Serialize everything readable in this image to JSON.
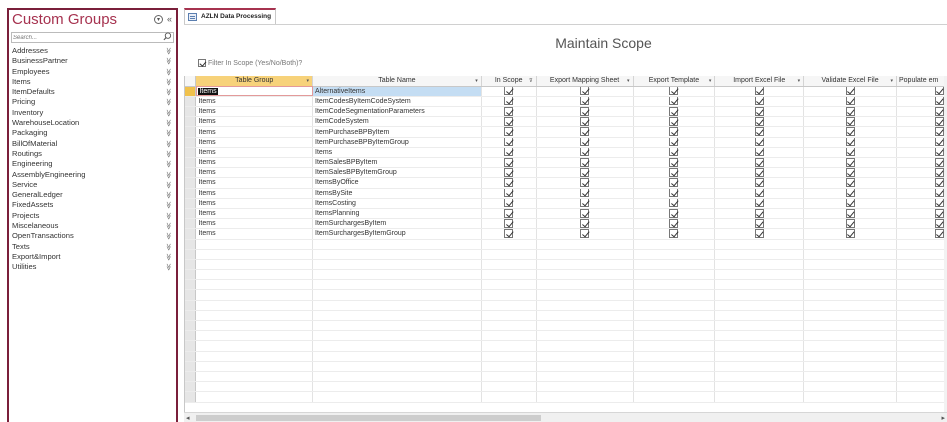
{
  "nav": {
    "title": "Custom Groups",
    "search_placeholder": "Search...",
    "items": [
      "Addresses",
      "BusinessPartner",
      "Employees",
      "Items",
      "ItemDefaults",
      "Pricing",
      "Inventory",
      "WarehouseLocation",
      "Packaging",
      "BillOfMaterial",
      "Routings",
      "Engineering",
      "AssemblyEngineering",
      "Service",
      "GeneralLedger",
      "FixedAssets",
      "Projects",
      "Miscelaneous",
      "OpenTransactions",
      "Texts",
      "Export&Import",
      "Utilities"
    ]
  },
  "tab": {
    "label": "AZLN Data Processing"
  },
  "form": {
    "title": "Maintain Scope",
    "filter_label": "Filter In Scope (Yes/No/Both)?",
    "filter_checked": true
  },
  "grid": {
    "columns": [
      "Table Group",
      "Table Name",
      "In Scope",
      "Export Mapping Sheet",
      "Export Template",
      "Import Excel File",
      "Validate Excel File",
      "Populate em"
    ],
    "rows": [
      {
        "group": "Items",
        "name": "AlternativeItems"
      },
      {
        "group": "Items",
        "name": "ItemCodesByItemCodeSystem"
      },
      {
        "group": "Items",
        "name": "ItemCodeSegmentationParameters"
      },
      {
        "group": "Items",
        "name": "ItemCodeSystem"
      },
      {
        "group": "Items",
        "name": "ItemPurchaseBPByItem"
      },
      {
        "group": "Items",
        "name": "ItemPurchaseBPByItemGroup"
      },
      {
        "group": "Items",
        "name": "Items"
      },
      {
        "group": "Items",
        "name": "ItemSalesBPByItem"
      },
      {
        "group": "Items",
        "name": "ItemSalesBPByItemGroup"
      },
      {
        "group": "Items",
        "name": "ItemsByOffice"
      },
      {
        "group": "Items",
        "name": "ItemsBySite"
      },
      {
        "group": "Items",
        "name": "ItemsCosting"
      },
      {
        "group": "Items",
        "name": "ItemsPlanning"
      },
      {
        "group": "Items",
        "name": "ItemSurchargesByItem"
      },
      {
        "group": "Items",
        "name": "ItemSurchargesByItemGroup"
      }
    ]
  },
  "colors": {
    "accent": "#a6324f",
    "header_highlight": "#f7d27a",
    "selected_row": "#c4ddf3"
  }
}
